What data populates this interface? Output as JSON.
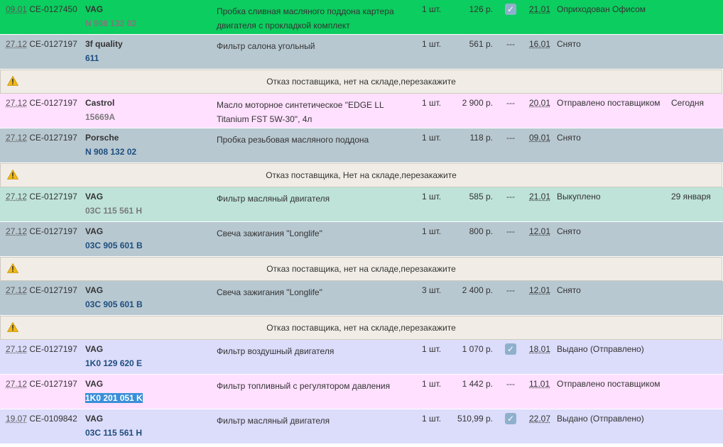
{
  "colors": {
    "green": "#0ccd5f",
    "gray": "#b8c8d1",
    "pink": "#ffe0ff",
    "mint": "#bfe3d9",
    "lavender": "#dcdcfb",
    "notice": "#f1ede6",
    "code_blue": "#1d4e7e",
    "code_gray": "#7a7a7a",
    "warning": "#f2b915"
  },
  "rows": [
    {
      "type": "item",
      "bg": "green",
      "date": "09.01",
      "order": "CE-0127450",
      "brand": "VAG",
      "code": "N 908 132 02",
      "code_color": "code_gray",
      "desc": "Пробка сливная масляного поддона картера двигателя с прокладкой комплект",
      "qty": "1 шт.",
      "price": "126 р.",
      "check": true,
      "due": "21.01",
      "status": "Оприходован Офисом",
      "extra": ""
    },
    {
      "type": "item",
      "bg": "gray",
      "date": "27.12",
      "order": "CE-0127197",
      "brand": "3f quality",
      "code": "611",
      "code_color": "code_blue",
      "desc": "Фильтр салона угольный",
      "qty": "1 шт.",
      "price": "561 р.",
      "check": false,
      "due": "16.01",
      "status": "Снято",
      "extra": ""
    },
    {
      "type": "notice",
      "icon": "warning-icon",
      "msg": "Отказ поставщика, нет на складе,перезакажите"
    },
    {
      "type": "item",
      "bg": "pink",
      "date": "27.12",
      "order": "CE-0127197",
      "brand": "Castrol",
      "code": "15669A",
      "code_color": "code_gray",
      "desc": "Масло моторное синтетическое \"EDGE LL Titanium FST 5W-30\", 4л",
      "qty": "1 шт.",
      "price": "2 900 р.",
      "check": false,
      "due": "20.01",
      "status": "Отправлено поставщиком",
      "extra": "Сегодня"
    },
    {
      "type": "item",
      "bg": "gray",
      "date": "27.12",
      "order": "CE-0127197",
      "brand": "Porsche",
      "code": "N 908 132 02",
      "code_color": "code_blue",
      "desc": "Пробка резьбовая масляного поддона",
      "qty": "1 шт.",
      "price": "118 р.",
      "check": false,
      "due": "09.01",
      "status": "Снято",
      "extra": ""
    },
    {
      "type": "notice",
      "icon": "warning-icon",
      "msg": "Отказ поставщика, Нет на складе,перезакажите"
    },
    {
      "type": "item",
      "bg": "mint",
      "date": "27.12",
      "order": "CE-0127197",
      "brand": "VAG",
      "code": "03C 115 561 H",
      "code_color": "code_gray",
      "desc": "Фильтр масляный двигателя",
      "qty": "1 шт.",
      "price": "585 р.",
      "check": false,
      "due": "21.01",
      "status": "Выкуплено",
      "extra": "29 января"
    },
    {
      "type": "item",
      "bg": "gray",
      "date": "27.12",
      "order": "CE-0127197",
      "brand": "VAG",
      "code": "03C 905 601 B",
      "code_color": "code_blue",
      "desc": "Свеча зажигания \"Longlife\"",
      "qty": "1 шт.",
      "price": "800 р.",
      "check": false,
      "due": "12.01",
      "status": "Снято",
      "extra": ""
    },
    {
      "type": "notice",
      "icon": "warning-icon",
      "msg": "Отказ поставщика, нет на складе,перезакажите"
    },
    {
      "type": "item",
      "bg": "gray",
      "date": "27.12",
      "order": "CE-0127197",
      "brand": "VAG",
      "code": "03C 905 601 B",
      "code_color": "code_blue",
      "desc": "Свеча зажигания \"Longlife\"",
      "qty": "3 шт.",
      "price": "2 400 р.",
      "check": false,
      "due": "12.01",
      "status": "Снято",
      "extra": ""
    },
    {
      "type": "notice",
      "icon": "warning-icon",
      "msg": "Отказ поставщика, нет на складе,перезакажите"
    },
    {
      "type": "item",
      "bg": "lavender",
      "date": "27.12",
      "order": "CE-0127197",
      "brand": "VAG",
      "code": "1K0 129 620 E",
      "code_color": "code_blue",
      "desc": "Фильтр воздушный двигателя",
      "qty": "1 шт.",
      "price": "1 070 р.",
      "check": true,
      "due": "18.01",
      "status": "Выдано (Отправлено)",
      "extra": ""
    },
    {
      "type": "item",
      "bg": "pink",
      "date": "27.12",
      "order": "CE-0127197",
      "brand": "VAG",
      "code": "1K0 201 051 K",
      "code_color": "code_blue",
      "highlight": true,
      "desc": "Фильтр топливный с регулятором давления",
      "qty": "1 шт.",
      "price": "1 442 р.",
      "check": false,
      "due": "11.01",
      "status": "Отправлено поставщиком",
      "extra": ""
    },
    {
      "type": "item",
      "bg": "lavender",
      "date": "19.07",
      "order": "CE-0109842",
      "brand": "VAG",
      "code": "03C 115 561 H",
      "code_color": "code_blue",
      "desc": "Фильтр масляный двигателя",
      "qty": "1 шт.",
      "price": "510,99 р.",
      "check": true,
      "due": "22.07",
      "status": "Выдано (Отправлено)",
      "extra": ""
    }
  ],
  "labels": {
    "dash": "---",
    "check": "✓"
  }
}
